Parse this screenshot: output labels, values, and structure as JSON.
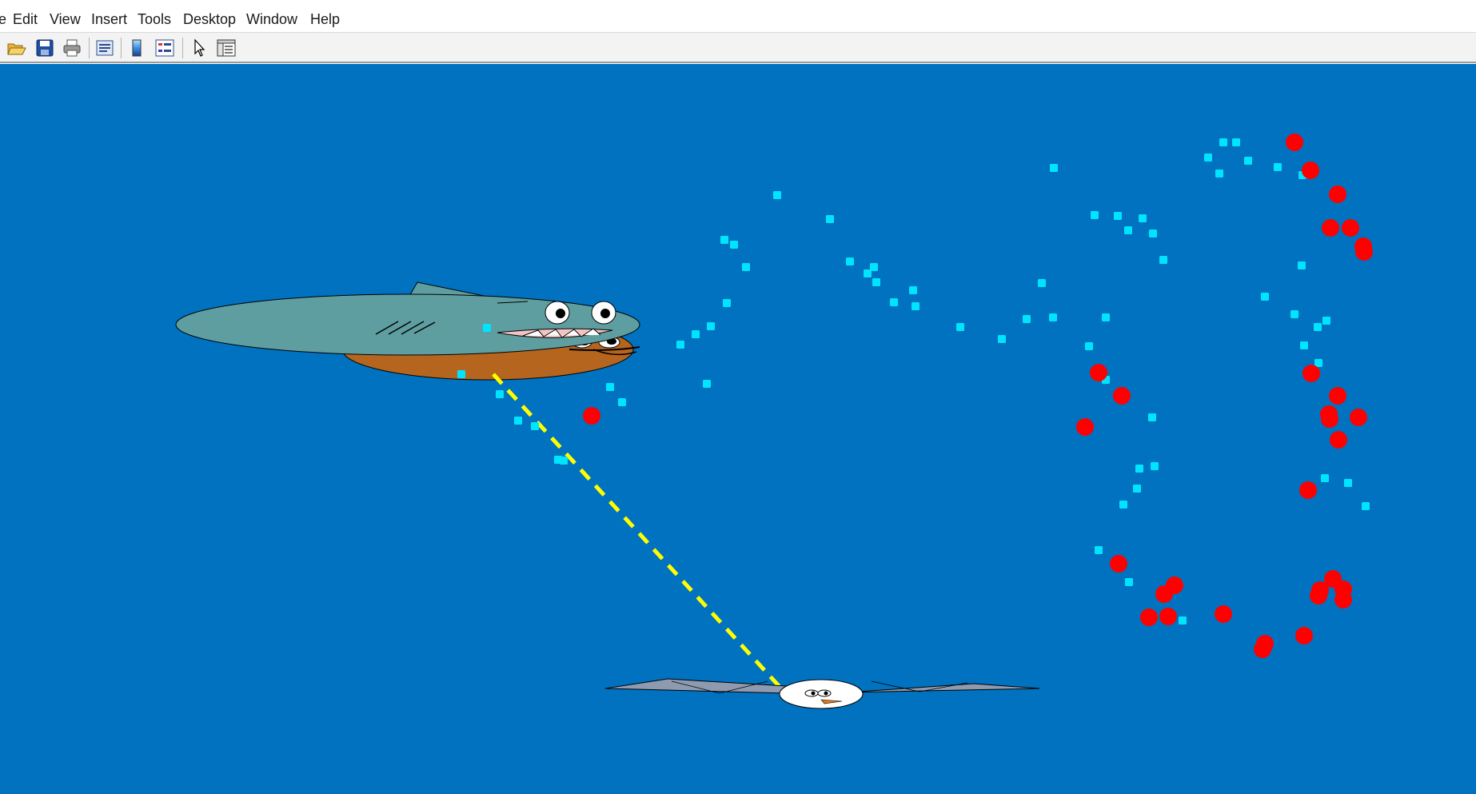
{
  "window": {
    "colors": {
      "background": "#0072C0",
      "menubar": "#FFFFFF",
      "toolbar": "#F3F3F3"
    }
  },
  "menubar": {
    "items": [
      {
        "label": "e"
      },
      {
        "label": "Edit"
      },
      {
        "label": "View"
      },
      {
        "label": "Insert"
      },
      {
        "label": "Tools"
      },
      {
        "label": "Desktop"
      },
      {
        "label": "Window"
      },
      {
        "label": "Help"
      }
    ]
  },
  "toolbar": {
    "tools": [
      {
        "icon": "open-folder-icon"
      },
      {
        "icon": "save-icon"
      },
      {
        "icon": "print-icon"
      },
      {
        "icon": "print-preview-icon"
      },
      {
        "icon": "colorbar-icon"
      },
      {
        "icon": "legend-icon"
      },
      {
        "icon": "pointer-icon"
      },
      {
        "icon": "property-inspector-icon"
      }
    ]
  },
  "scene": {
    "colors": {
      "food_pellet": "#00E5FF",
      "red_ball": "#FF0000",
      "laser": "#FFFF00",
      "shark_body": "#5F9EA0",
      "fish_body": "#B5651D",
      "gull_body": "#FFFFFF",
      "gull_wing": "#8E9AB0"
    },
    "characters": [
      "shark",
      "brown-fish",
      "seagull"
    ]
  }
}
